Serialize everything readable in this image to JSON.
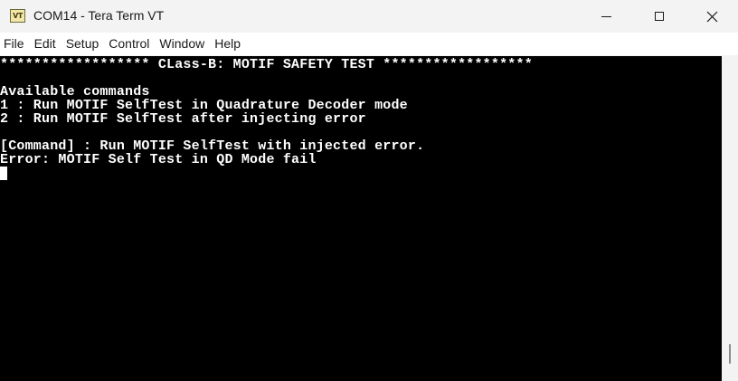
{
  "window": {
    "icon_text": "VT",
    "title": "COM14 - Tera Term VT"
  },
  "menu": {
    "items": [
      "File",
      "Edit",
      "Setup",
      "Control",
      "Window",
      "Help"
    ]
  },
  "terminal": {
    "lines": [
      "****************** CLass-B: MOTIF SAFETY TEST ******************",
      "",
      "Available commands",
      "1 : Run MOTIF SelfTest in Quadrature Decoder mode",
      "2 : Run MOTIF SelfTest after injecting error",
      "",
      "[Command] : Run MOTIF SelfTest with injected error.",
      "Error: MOTIF Self Test in QD Mode fail"
    ]
  },
  "icons": {
    "minimize": "minimize-icon",
    "maximize": "maximize-icon",
    "close": "close-icon",
    "app": "teraterm-app-icon"
  }
}
